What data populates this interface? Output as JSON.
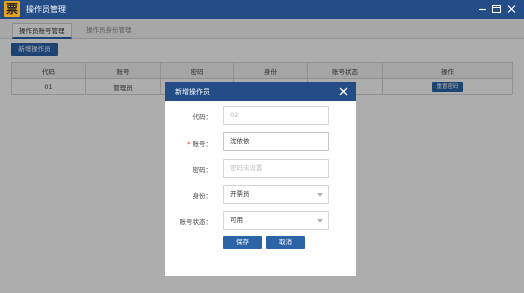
{
  "app": {
    "logo_text": "票",
    "window_title": "操作员管理"
  },
  "tabs": [
    {
      "label": "操作员账号管理",
      "active": true
    },
    {
      "label": "操作员身份管理",
      "active": false
    }
  ],
  "toolbar": {
    "add_label": "新增操作员"
  },
  "table": {
    "columns": [
      "代码",
      "账号",
      "密码",
      "身份",
      "账号状态",
      "操作"
    ],
    "rows": [
      {
        "code": "01",
        "account": "管理员",
        "action": "重置密码"
      }
    ]
  },
  "modal": {
    "title": "新增操作员",
    "fields": {
      "code": {
        "label": "代码：",
        "value": "02"
      },
      "account": {
        "label": "账号：",
        "value": "沈依依",
        "required_mark": "*"
      },
      "password": {
        "label": "密码：",
        "placeholder": "密码未设置"
      },
      "role": {
        "label": "身份：",
        "value": "开票员"
      },
      "status": {
        "label": "账号状态：",
        "value": "可用"
      }
    },
    "save_label": "保存",
    "cancel_label": "取消"
  },
  "colors": {
    "header": "#244c86",
    "accent": "#2c64a8",
    "logo": "#e8a317",
    "required": "#d9362b"
  },
  "icons": {
    "window_controls": [
      "minimize-icon",
      "restore-icon",
      "close-icon"
    ],
    "modal_close": "close-icon",
    "select_caret": "chevron-down-icon"
  }
}
